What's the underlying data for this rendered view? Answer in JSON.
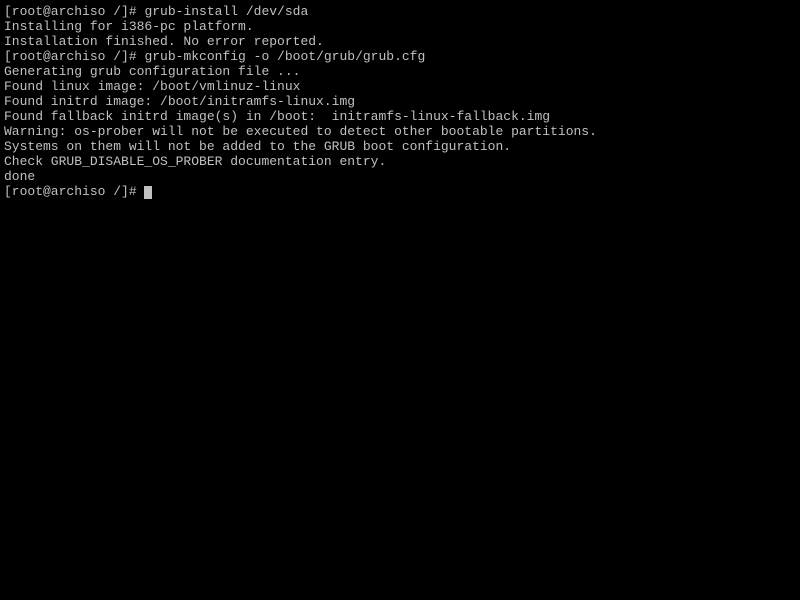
{
  "terminal": {
    "lines": [
      {
        "prompt": "[root@archiso /]# ",
        "command": "grub-install /dev/sda"
      },
      {
        "text": "Installing for i386-pc platform."
      },
      {
        "text": "Installation finished. No error reported."
      },
      {
        "prompt": "[root@archiso /]# ",
        "command": "grub-mkconfig -o /boot/grub/grub.cfg"
      },
      {
        "text": "Generating grub configuration file ..."
      },
      {
        "text": "Found linux image: /boot/vmlinuz-linux"
      },
      {
        "text": "Found initrd image: /boot/initramfs-linux.img"
      },
      {
        "text": "Found fallback initrd image(s) in /boot:  initramfs-linux-fallback.img"
      },
      {
        "text": "Warning: os-prober will not be executed to detect other bootable partitions."
      },
      {
        "text": "Systems on them will not be added to the GRUB boot configuration."
      },
      {
        "text": "Check GRUB_DISABLE_OS_PROBER documentation entry."
      },
      {
        "text": "done"
      },
      {
        "prompt": "[root@archiso /]# ",
        "command": "",
        "cursor": true
      }
    ]
  }
}
